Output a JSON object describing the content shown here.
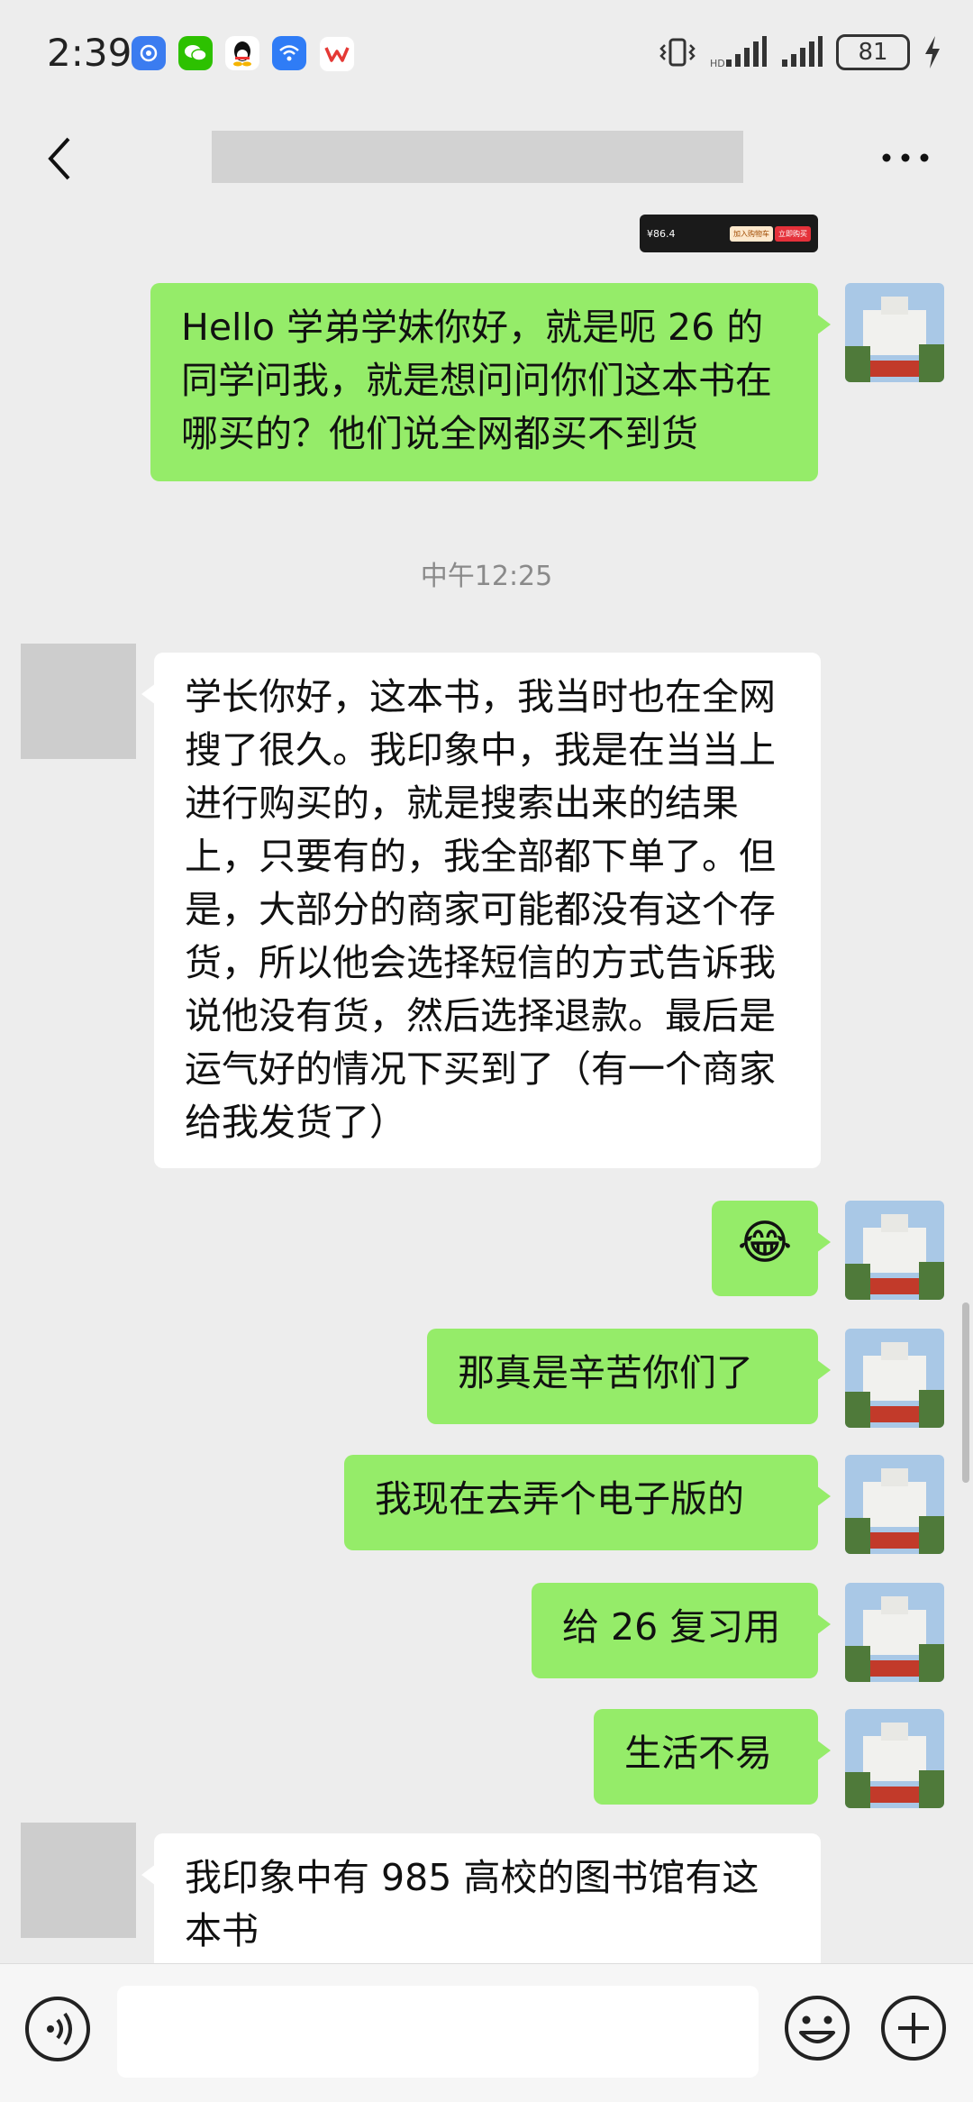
{
  "status_bar": {
    "time": "2:39",
    "battery": "81",
    "app_icons": [
      "find-icon",
      "wechat-icon",
      "qq-icon",
      "wifi-app-icon",
      "wps-icon"
    ]
  },
  "header": {
    "title": "",
    "back_icon": "chevron-left-icon",
    "more_icon": "ellipsis-icon"
  },
  "ad_snippet": {
    "price": "¥86.4",
    "add_cart": "加入购物车",
    "buy_now": "立即购买"
  },
  "messages": [
    {
      "side": "right",
      "text": "Hello 学弟学妹你好，就是呃 26 的同学问我，就是想问问你们这本书在哪买的？他们说全网都买不到货"
    },
    {
      "side": "time",
      "text": "中午12:25"
    },
    {
      "side": "left",
      "text": "学长你好，这本书，我当时也在全网搜了很久。我印象中，我是在当当上进行购买的，就是搜索出来的结果上，只要有的，我全部都下单了。但是，大部分的商家可能都没有这个存货，所以他会选择短信的方式告诉我说他没有货，然后选择退款。最后是运气好的情况下买到了（有一个商家给我发货了）"
    },
    {
      "side": "right",
      "emoji": "😂"
    },
    {
      "side": "right",
      "text": "那真是辛苦你们了"
    },
    {
      "side": "right",
      "text": "我现在去弄个电子版的"
    },
    {
      "side": "right",
      "text": "给 26 复习用"
    },
    {
      "side": "right",
      "text": "生活不易"
    },
    {
      "side": "left",
      "text": "我印象中有 985 高校的图书馆有这本书"
    }
  ],
  "input_bar": {
    "voice_icon": "voice-icon",
    "emoji_icon": "smile-icon",
    "plus_icon": "plus-icon",
    "placeholder": ""
  },
  "colors": {
    "sent_bubble": "#95ec69",
    "received_bubble": "#ffffff",
    "background": "#ededed"
  }
}
